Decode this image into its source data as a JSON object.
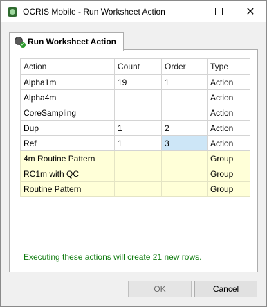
{
  "window": {
    "title": "OCRIS Mobile - Run Worksheet Action",
    "icon": "app-logo-icon",
    "controls": {
      "minimize": "minimize-icon",
      "maximize": "maximize-icon",
      "close": "✕"
    }
  },
  "tab": {
    "label": "Run Worksheet Action",
    "icon": "gear-check-icon"
  },
  "grid": {
    "columns": [
      "Action",
      "Count",
      "Order",
      "Type"
    ],
    "rows": [
      {
        "action": "Alpha1m",
        "count": "19",
        "order": "1",
        "type": "Action"
      },
      {
        "action": "Alpha4m",
        "count": "",
        "order": "",
        "type": "Action"
      },
      {
        "action": "CoreSampling",
        "count": "",
        "order": "",
        "type": "Action"
      },
      {
        "action": "Dup",
        "count": "1",
        "order": "2",
        "type": "Action"
      },
      {
        "action": "Ref",
        "count": "1",
        "order": "3",
        "type": "Action"
      },
      {
        "action": "4m Routine Pattern",
        "count": "",
        "order": "",
        "type": "Group"
      },
      {
        "action": "RC1m with QC",
        "count": "",
        "order": "",
        "type": "Group"
      },
      {
        "action": "Routine Pattern",
        "count": "",
        "order": "",
        "type": "Group"
      }
    ]
  },
  "message": "Executing these actions will create 21 new rows.",
  "buttons": {
    "ok": "OK",
    "cancel": "Cancel"
  },
  "colors": {
    "group_row": "#ffffd8",
    "selected_cell": "#cde6f7",
    "message_text": "#107c10"
  }
}
